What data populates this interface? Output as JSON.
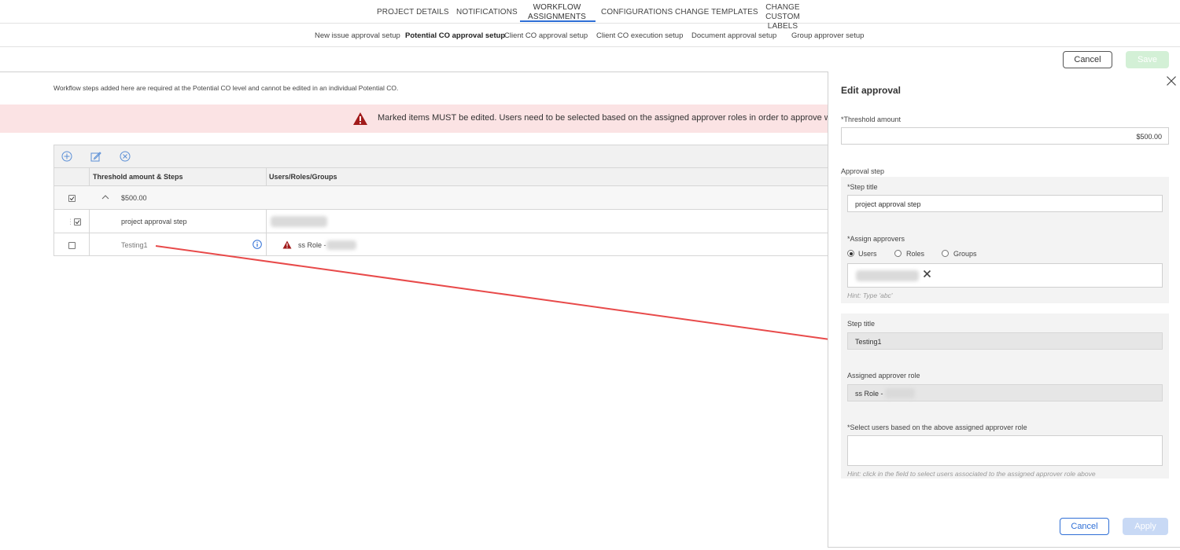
{
  "top_tabs": [
    "PROJECT DETAILS",
    "NOTIFICATIONS",
    "WORKFLOW ASSIGNMENTS",
    "CONFIGURATIONS",
    "CHANGE TEMPLATES",
    "CHANGE CUSTOM LABELS"
  ],
  "top_tabs_lines": {
    "workflow_l1": "WORKFLOW",
    "workflow_l2": "ASSIGNMENTS",
    "custom_l1": "CHANGE CUSTOM",
    "custom_l2": "LABELS"
  },
  "sub_tabs": [
    "New issue approval setup",
    "Potential CO approval setup",
    "Client CO approval setup",
    "Client CO execution setup",
    "Document approval setup",
    "Group approver setup"
  ],
  "actions": {
    "cancel": "Cancel",
    "save": "Save"
  },
  "info_text": "Workflow steps added here are required at the Potential CO level and cannot be edited in an individual Potential CO.",
  "warning_text": "Marked items MUST be edited. Users need to be selected based on the assigned approver roles in order to approve workflow.",
  "table": {
    "headers": {
      "steps": "Threshold amount & Steps",
      "users": "Users/Roles/Groups"
    },
    "group_row": {
      "amount": "$500.00"
    },
    "rows": [
      {
        "step": "project approval step",
        "users": ""
      },
      {
        "step": "Testing1",
        "users": "ss Role -"
      }
    ]
  },
  "panel": {
    "title": "Edit approval",
    "threshold_label": "*Threshold amount",
    "threshold_value": "$500.00",
    "approval_step_label": "Approval step",
    "step_title_label": "*Step title",
    "step_title_value": "project approval step",
    "assign_label": "*Assign approvers",
    "radio_users": "Users",
    "radio_roles": "Roles",
    "radio_groups": "Groups",
    "hint_abc": "Hint: Type 'abc'",
    "step_title2_label": "Step title",
    "step_title2_value": "Testing1",
    "role_label": "Assigned approver role",
    "role_value": "ss Role -",
    "select_users_label": "*Select users based on the above assigned approver role",
    "select_hint": "Hint: click in the field to select users associated to the assigned approver role above",
    "cancel": "Cancel",
    "apply": "Apply"
  },
  "colors": {
    "accent": "#2f6fd6",
    "warning_bg": "#fbe3e4",
    "warning_icon": "#a11a1a",
    "arrow": "#e84a4a",
    "save_disabled": "#d3f0d6",
    "apply_disabled": "#c8d9f5"
  }
}
